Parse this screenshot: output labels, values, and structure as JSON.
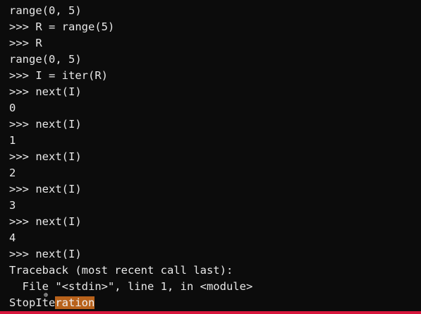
{
  "terminal": {
    "lines": [
      "range(0, 5)",
      ">>> R = range(5)",
      ">>> R",
      "range(0, 5)",
      ">>> I = iter(R)",
      ">>> next(I)",
      "0",
      ">>> next(I)",
      "1",
      ">>> next(I)",
      "2",
      ">>> next(I)",
      "3",
      ">>> next(I)",
      "4",
      ">>> next(I)",
      "Traceback (most recent call last):",
      "  File \"<stdin>\", line 1, in <module>"
    ],
    "last_line": {
      "plain": "StopIte",
      "highlighted": "ration"
    },
    "colors": {
      "background": "#0c0c0c",
      "text": "#e8e8e8",
      "selection": "#b8621b",
      "bottom_bar": "#d6173c"
    },
    "icons": {
      "cursor": "text-cursor-icon"
    }
  }
}
